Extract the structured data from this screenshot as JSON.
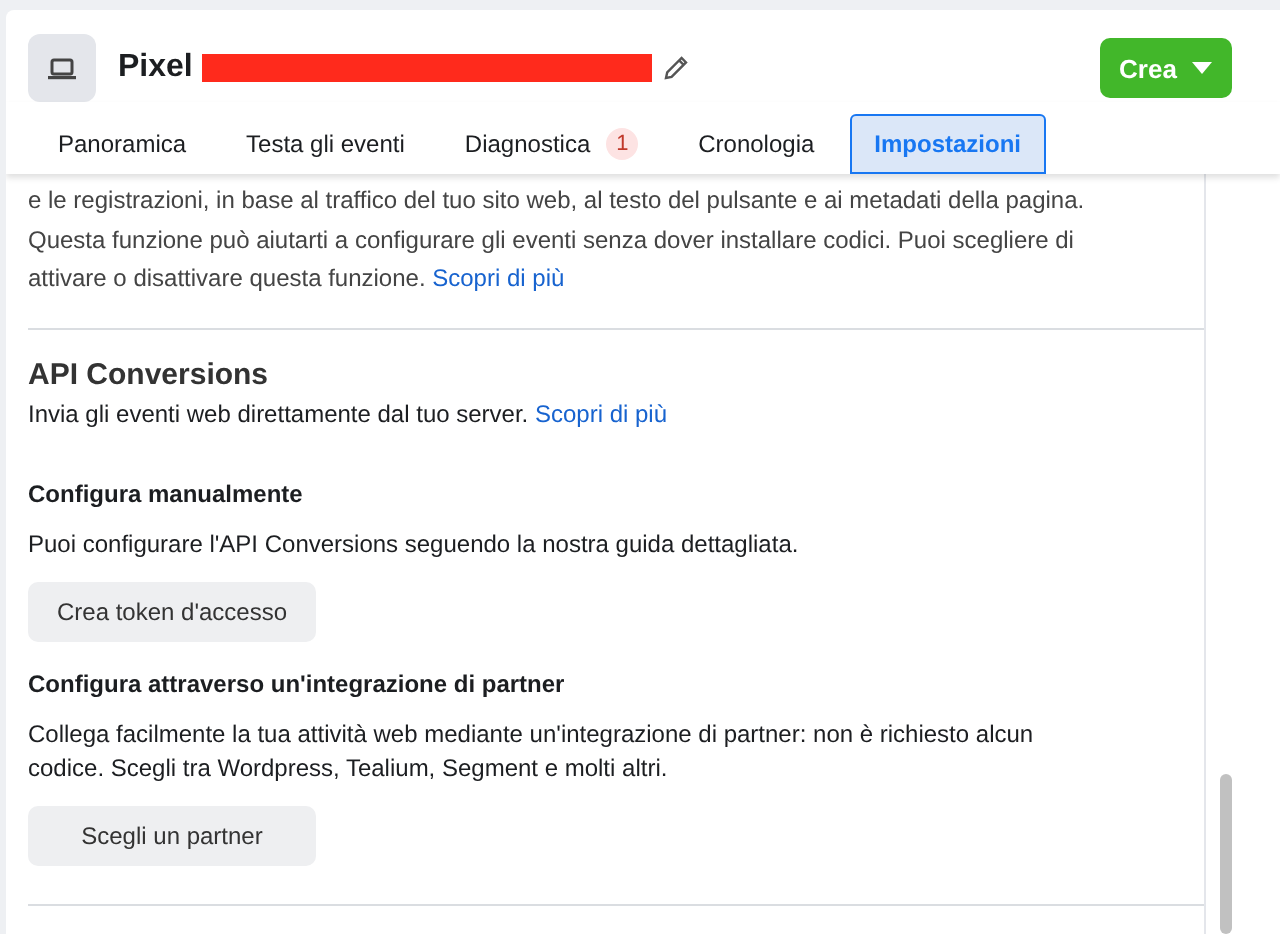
{
  "header": {
    "title": "Pixel",
    "redacted": true,
    "create_button": "Crea"
  },
  "tabs": [
    {
      "label": "Panoramica",
      "selected": false
    },
    {
      "label": "Testa gli eventi",
      "selected": false
    },
    {
      "label": "Diagnostica",
      "selected": false,
      "badge": "1"
    },
    {
      "label": "Cronologia",
      "selected": false
    },
    {
      "label": "Impostazioni",
      "selected": true
    }
  ],
  "intro": {
    "text": "e le registrazioni, in base al traffico del tuo sito web, al testo del pulsante e ai metadati della pagina. Questa funzione può aiutarti a configurare gli eventi senza dover installare codici. Puoi scegliere di attivare o disattivare questa funzione.",
    "link": "Scopri di più"
  },
  "section": {
    "title": "API Conversions",
    "description": "Invia gli eventi web direttamente dal tuo server.",
    "link": "Scopri di più",
    "options": [
      {
        "title": "Configura manualmente",
        "text": "Puoi configurare l'API Conversions seguendo la nostra guida dettagliata.",
        "button": "Crea token d'accesso"
      },
      {
        "title": "Configura attraverso un'integrazione di partner",
        "text": "Collega facilmente la tua attività web mediante un'integrazione di partner: non è richiesto alcun codice. Scegli tra Wordpress, Tealium, Segment e molti altri.",
        "button": "Scegli un partner"
      }
    ]
  }
}
